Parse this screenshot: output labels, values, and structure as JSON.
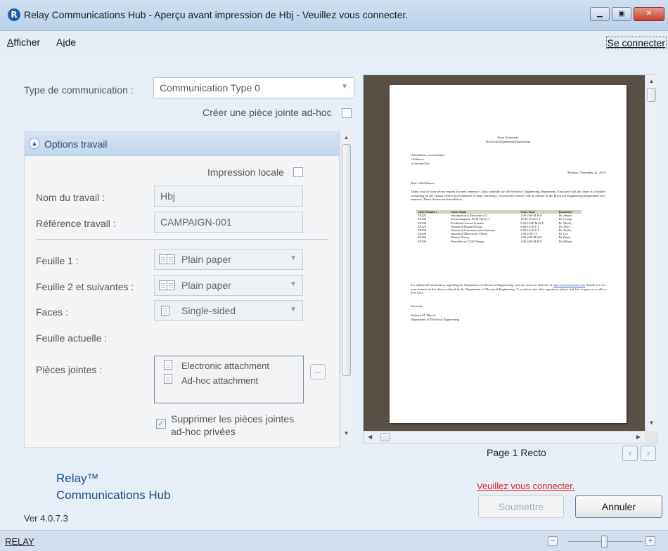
{
  "window": {
    "title": "Relay Communications Hub - Aperçu avant impression de Hbj - Veuillez vous connecter.",
    "app_icon": "R",
    "controls": [
      "minimize-icon",
      "maximize-icon",
      "close-icon"
    ]
  },
  "menu": {
    "items": [
      {
        "label_prefix": "A",
        "label_rest": "fficher"
      },
      {
        "label_prefix": "Ai",
        "label_rest": "de",
        "underline_index": 1
      }
    ],
    "connect_label": "Se connecter"
  },
  "form": {
    "comm_type_label": "Type de communication :",
    "comm_type_value": "Communication Type 0",
    "adhoc_label": "Créer une pièce jointe ad-hoc",
    "adhoc_checked": false
  },
  "job_options": {
    "header": "Options travail",
    "local_print_label": "Impression locale",
    "local_print_checked": false,
    "job_name_label": "Nom du travail :",
    "job_name_value": "Hbj",
    "job_ref_label": "Référence travail :",
    "job_ref_value": "CAMPAIGN-001",
    "sheet1_label": "Feuille 1 :",
    "sheet1_value": "Plain paper",
    "sheet2_label": "Feuille 2 et suivantes :",
    "sheet2_value": "Plain paper",
    "faces_label": "Faces :",
    "faces_value": "Single-sided",
    "current_sheet_label": "Feuille actuelle :",
    "attachments_label": "Pièces jointes :",
    "attachments": [
      "Electronic attachment",
      "Ad-hoc attachment"
    ],
    "ellipsis_label": "...",
    "suppress_label_1": "Supprimer les pièces jointes",
    "suppress_label_2": "ad-hoc privées",
    "suppress_checked": true
  },
  "preview": {
    "page_label": "Page 1 Recto",
    "document": {
      "org": "State University",
      "dept": "Electrical Engineering Department",
      "addr1": "«FirstName» «LastName»",
      "addr2": "«Address»",
      "addr3": "«CityStateZip»",
      "date": "Monday, November 22, 2010",
      "greeting": "Dear «FirstName»,",
      "body1": "Thank you for your recent request for next semester's class schedule for the Electrical Engineering Department. Enclosed with this letter is a booklet containing all the classes offered next semester at State University. Several new classes will be offered in the Electrical Engineering Department next semester. These classes are listed below.",
      "table_headers": [
        "Class Numbe r",
        "Class Name",
        "Class Time",
        "Instructor"
      ],
      "table_rows": [
        [
          "EE220",
          "Introduction to Electronics II",
          "1:00-2:00 M,W,F",
          "Dr. Jensen"
        ],
        [
          "EE230",
          "Electromagnetic Field Theory I",
          "10:00-11:30 T,T",
          "Dr. Crump"
        ],
        [
          "EE300",
          "Feedback Control Systems",
          "9:00-10:00 M,W,F",
          "Dr. Mosby"
        ],
        [
          "EE325",
          "Advanced Digital Design",
          "9:00-10:30 T,T",
          "Dr. Alley"
        ],
        [
          "EE350",
          "Advanced Communication Systems",
          "9:00-10:30 T,T",
          "Dr. Taylor"
        ],
        [
          "EE400",
          "Advanced Microwave Theory",
          "1:00-2:30 T,T",
          "Dr. Lee"
        ],
        [
          "EE450",
          "Plasma Theory",
          "1:00-2:00 M,W,F",
          "Dr. Davis"
        ],
        [
          "EE500",
          "Principles of VLSI Design",
          "3:00-4:00 M,W,F",
          "Dr. Ellison"
        ]
      ],
      "body2_a": "For additional information regarding the Department of Electrical Engineering, you can visit our Web site at",
      "body2_link": "http://www.ee.stateu.edu",
      "body2_b": ". Thank you for your interest in the classes offered in the Department of Electrical Engineering. If you have any other questions, please feel free to give us a call at 555-1212.",
      "closing": "Sincerely,",
      "signer": "Kathryn M. Hinsch",
      "signer_dept": "Department of Electrical Engineering"
    }
  },
  "brand": {
    "line1": "Relay™",
    "line2": "Communications Hub"
  },
  "version": "Ver 4.0.7.3",
  "connect_prompt": "Veuillez vous connecter.",
  "buttons": {
    "submit": "Soumettre",
    "cancel": "Annuler"
  },
  "status": {
    "text": "RELAY",
    "zoom_minus": "−",
    "zoom_plus": "+",
    "zoom_level": 0.45
  },
  "colors": {
    "accent": "#1f4f8a",
    "link_red": "#e02020",
    "title_bg": "#c3d7ee"
  }
}
